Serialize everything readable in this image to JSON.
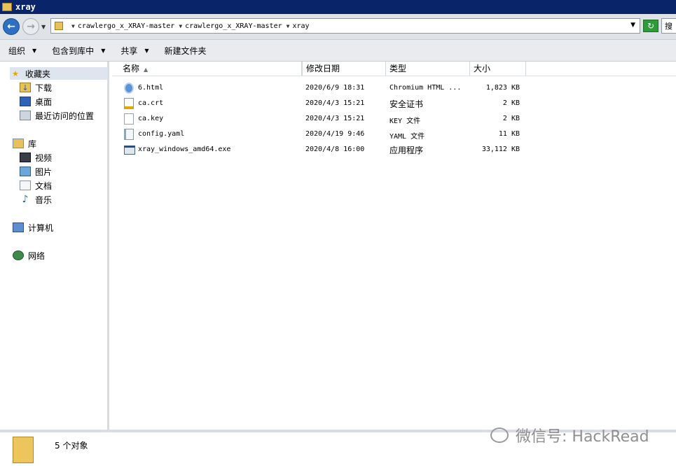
{
  "window": {
    "title": "xray"
  },
  "address": {
    "crumbs": [
      "crawlergo_x_XRAY-master",
      "crawlergo_x_XRAY-master",
      "xray"
    ],
    "search_placeholder": "搜"
  },
  "toolbar": {
    "organize": "组织",
    "include_in_library": "包含到库中",
    "share": "共享",
    "new_folder": "新建文件夹"
  },
  "navpane": {
    "favorites": "收藏夹",
    "downloads": "下载",
    "desktop": "桌面",
    "recent": "最近访问的位置",
    "libraries": "库",
    "videos": "视频",
    "pictures": "图片",
    "documents": "文档",
    "music": "音乐",
    "computer": "计算机",
    "network": "网络"
  },
  "columns": {
    "name": "名称",
    "date": "修改日期",
    "type": "类型",
    "size": "大小"
  },
  "files": [
    {
      "name": "6.html",
      "date": "2020/6/9 18:31",
      "type": "Chromium HTML ...",
      "size": "1,823 KB",
      "icon": "chromium-html-icon"
    },
    {
      "name": "ca.crt",
      "date": "2020/4/3 15:21",
      "type": "安全证书",
      "size": "2 KB",
      "icon": "certificate-icon"
    },
    {
      "name": "ca.key",
      "date": "2020/4/3 15:21",
      "type": "KEY 文件",
      "size": "2 KB",
      "icon": "blank-file-icon"
    },
    {
      "name": "config.yaml",
      "date": "2020/4/19 9:46",
      "type": "YAML 文件",
      "size": "11 KB",
      "icon": "yaml-file-icon"
    },
    {
      "name": "xray_windows_amd64.exe",
      "date": "2020/4/8 16:00",
      "type": "应用程序",
      "size": "33,112 KB",
      "icon": "exe-file-icon"
    }
  ],
  "status": {
    "count": "5 个对象"
  },
  "watermark": {
    "text": "微信号: HackRead"
  }
}
